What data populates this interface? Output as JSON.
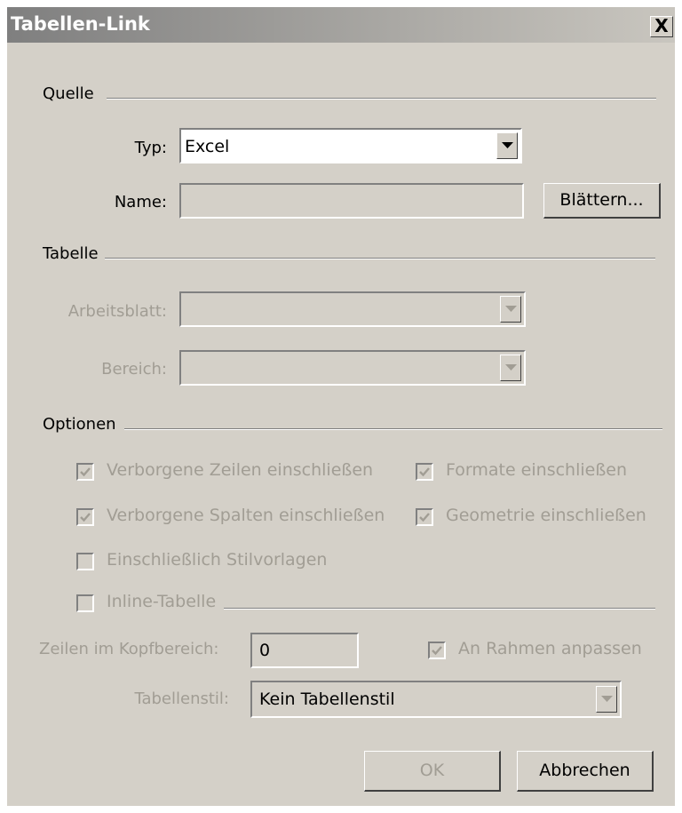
{
  "window": {
    "title": "Tabellen-Link",
    "close_glyph": "X"
  },
  "quelle": {
    "section_label": "Quelle",
    "typ_label": "Typ:",
    "typ_value": "Excel",
    "name_label": "Name:",
    "name_value": "",
    "browse_label": "Blättern..."
  },
  "tabelle": {
    "section_label": "Tabelle",
    "arbeitsblatt_label": "Arbeitsblatt:",
    "bereich_label": "Bereich:"
  },
  "optionen": {
    "section_label": "Optionen",
    "checkboxes": [
      {
        "label": "Verborgene Zeilen einschließen",
        "checked": true,
        "enabled": false
      },
      {
        "label": "Formate einschließen",
        "checked": true,
        "enabled": false
      },
      {
        "label": "Verborgene Spalten einschließen",
        "checked": true,
        "enabled": false
      },
      {
        "label": "Geometrie einschließen",
        "checked": true,
        "enabled": false
      },
      {
        "label": "Einschließlich Stilvorlagen",
        "checked": false,
        "enabled": false
      },
      {
        "label": "Inline-Tabelle",
        "checked": false,
        "enabled": false
      }
    ],
    "kopf_label": "Zeilen im Kopfbereich:",
    "kopf_value": "0",
    "rahmen_label": "An Rahmen anpassen",
    "rahmen_checked": true,
    "stil_label": "Tabellenstil:",
    "stil_value": "Kein Tabellenstil"
  },
  "buttons": {
    "ok_label": "OK",
    "cancel_label": "Abbrechen"
  },
  "colors": {
    "dialog_bg": "#d4d0c8",
    "disabled_text": "#a19d94"
  }
}
